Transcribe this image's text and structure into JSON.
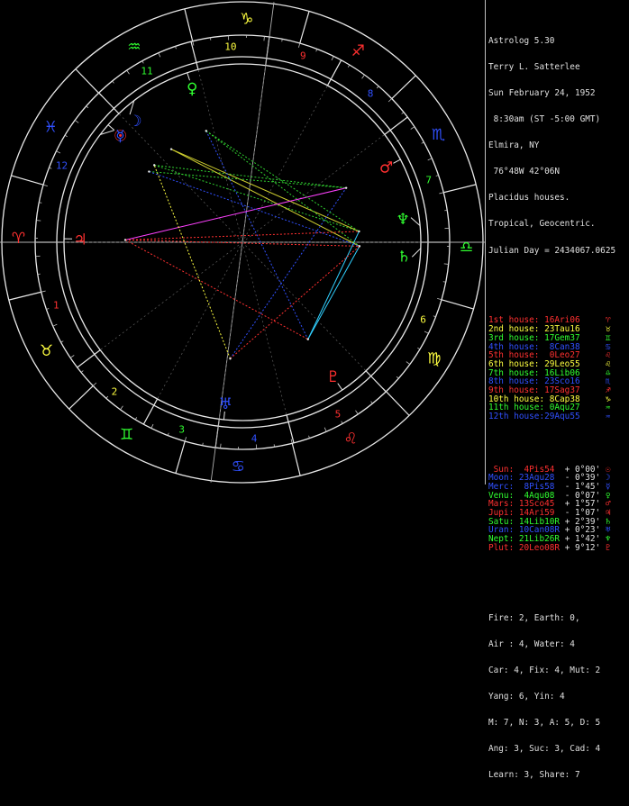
{
  "header": [
    "Astrolog 5.30",
    "Terry L. Satterlee",
    "Sun February 24, 1952",
    " 8:30am (ST -5:00 GMT)",
    "Elmira, NY",
    " 76°48W 42°06N",
    "Placidus houses.",
    "Tropical, Geocentric.",
    "Julian Day = 2434067.0625"
  ],
  "houses": [
    {
      "label": "1st house:",
      "value": "16Ari06",
      "glyph": "♈",
      "color": "#ff3030"
    },
    {
      "label": "2nd house:",
      "value": "23Tau16",
      "glyph": "♉",
      "color": "#ffff40"
    },
    {
      "label": "3rd house:",
      "value": "17Gem37",
      "glyph": "♊",
      "color": "#30ff30"
    },
    {
      "label": "4th house:",
      "value": " 8Can38",
      "glyph": "♋",
      "color": "#3050ff"
    },
    {
      "label": "5th house:",
      "value": " 0Leo27",
      "glyph": "♌",
      "color": "#ff3030"
    },
    {
      "label": "6th house:",
      "value": "29Leo55",
      "glyph": "♌",
      "color": "#ffff40"
    },
    {
      "label": "7th house:",
      "value": "16Lib06",
      "glyph": "♎",
      "color": "#30ff30"
    },
    {
      "label": "8th house:",
      "value": "23Sco16",
      "glyph": "♏",
      "color": "#3050ff"
    },
    {
      "label": "9th house:",
      "value": "17Sag37",
      "glyph": "♐",
      "color": "#ff3030"
    },
    {
      "label": "10th house:",
      "value": " 8Cap38",
      "glyph": "♑",
      "color": "#ffff40"
    },
    {
      "label": "11th house:",
      "value": " 0Aqu27",
      "glyph": "♒",
      "color": "#30ff30"
    },
    {
      "label": "12th house:",
      "value": "29Aqu55",
      "glyph": "♒",
      "color": "#3050ff"
    }
  ],
  "planets": [
    {
      "name": "Sun:",
      "pos": " 4Pis54",
      "speed": "+ 0°00'",
      "glyph": "☉",
      "color": "#ff3030"
    },
    {
      "name": "Moon:",
      "pos": "23Aqu28",
      "speed": "- 0°39'",
      "glyph": "☽",
      "color": "#3050ff"
    },
    {
      "name": "Merc:",
      "pos": " 8Pis58",
      "speed": "- 1°45'",
      "glyph": "☿",
      "color": "#3050ff"
    },
    {
      "name": "Venu:",
      "pos": " 4Aqu08",
      "speed": "- 0°07'",
      "glyph": "♀",
      "color": "#30ff30"
    },
    {
      "name": "Mars:",
      "pos": "13Sco45",
      "speed": "+ 1°57'",
      "glyph": "♂",
      "color": "#ff3030"
    },
    {
      "name": "Jupi:",
      "pos": "14Ari59",
      "speed": "- 1°07'",
      "glyph": "♃",
      "color": "#ff3030"
    },
    {
      "name": "Satu:",
      "pos": "14Lib10R",
      "speed": "+ 2°39'",
      "glyph": "♄",
      "color": "#30ff30"
    },
    {
      "name": "Uran:",
      "pos": "10Can08R",
      "speed": "+ 0°23'",
      "glyph": "♅",
      "color": "#3050ff"
    },
    {
      "name": "Nept:",
      "pos": "21Lib26R",
      "speed": "+ 1°42'",
      "glyph": "♆",
      "color": "#30ff30"
    },
    {
      "name": "Plut:",
      "pos": "20Leo08R",
      "speed": "+ 9°12'",
      "glyph": "♇",
      "color": "#ff3030"
    }
  ],
  "summary": [
    "Fire: 2, Earth: 0,",
    "Air : 4, Water: 4",
    "Car: 4, Fix: 4, Mut: 2",
    "Yang: 6, Yin: 4",
    "M: 7, N: 3, A: 5, D: 5",
    "Ang: 3, Suc: 3, Cad: 4",
    "Learn: 3, Share: 7"
  ],
  "wheel": {
    "signs": [
      {
        "glyph": "♈",
        "color": "#ff3030"
      },
      {
        "glyph": "♉",
        "color": "#ffff40"
      },
      {
        "glyph": "♊",
        "color": "#30ff30"
      },
      {
        "glyph": "♋",
        "color": "#3050ff"
      },
      {
        "glyph": "♌",
        "color": "#ff3030"
      },
      {
        "glyph": "♍",
        "color": "#ffff40"
      },
      {
        "glyph": "♎",
        "color": "#30ff30"
      },
      {
        "glyph": "♏",
        "color": "#3050ff"
      },
      {
        "glyph": "♐",
        "color": "#ff3030"
      },
      {
        "glyph": "♑",
        "color": "#ffff40"
      },
      {
        "glyph": "♒",
        "color": "#30ff30"
      },
      {
        "glyph": "♓",
        "color": "#3050ff"
      }
    ],
    "house_numbers": [
      "1",
      "2",
      "3",
      "4",
      "5",
      "6",
      "7",
      "8",
      "9",
      "10",
      "11",
      "12"
    ],
    "house_number_colors": [
      "#ff3030",
      "#ffff40",
      "#30ff30",
      "#3050ff",
      "#ff3030",
      "#ffff40",
      "#30ff30",
      "#3050ff",
      "#ff3030",
      "#ffff40",
      "#30ff30",
      "#3050ff"
    ],
    "house_cusps_deg": [
      16.1,
      53.27,
      77.62,
      98.63,
      120.45,
      149.92,
      196.1,
      233.27,
      257.62,
      278.63,
      300.45,
      329.92
    ],
    "ascendant_deg": 16.1,
    "planet_longitudes_deg": [
      334.9,
      323.47,
      338.97,
      304.13,
      223.75,
      14.98,
      194.17,
      100.13,
      201.43,
      140.13
    ],
    "aspects": [
      {
        "from": 0,
        "to": 4,
        "color": "#30d030",
        "style": "dot"
      },
      {
        "from": 0,
        "to": 8,
        "color": "#30d030",
        "style": "dot"
      },
      {
        "from": 1,
        "to": 8,
        "color": "#d0d030",
        "style": "solid"
      },
      {
        "from": 1,
        "to": 6,
        "color": "#d0d030",
        "style": "solid"
      },
      {
        "from": 2,
        "to": 4,
        "color": "#30d030",
        "style": "dot"
      },
      {
        "from": 3,
        "to": 9,
        "color": "#3050ff",
        "style": "dot"
      },
      {
        "from": 5,
        "to": 4,
        "color": "#ff40ff",
        "style": "solid"
      },
      {
        "from": 5,
        "to": 6,
        "color": "#ff3030",
        "style": "dot"
      },
      {
        "from": 5,
        "to": 8,
        "color": "#ff3030",
        "style": "dot"
      },
      {
        "from": 5,
        "to": 9,
        "color": "#ff3030",
        "style": "dot"
      },
      {
        "from": 6,
        "to": 9,
        "color": "#30d0ff",
        "style": "solid"
      },
      {
        "from": 8,
        "to": 9,
        "color": "#30d0ff",
        "style": "solid"
      },
      {
        "from": 7,
        "to": 0,
        "color": "#ffff40",
        "style": "dot"
      },
      {
        "from": 7,
        "to": 4,
        "color": "#3050ff",
        "style": "dot"
      },
      {
        "from": 7,
        "to": 6,
        "color": "#ff3030",
        "style": "dot"
      },
      {
        "from": 3,
        "to": 6,
        "color": "#30d030",
        "style": "dot"
      },
      {
        "from": 3,
        "to": 8,
        "color": "#30d030",
        "style": "dot"
      },
      {
        "from": 2,
        "to": 6,
        "color": "#3050ff",
        "style": "dot"
      }
    ]
  }
}
